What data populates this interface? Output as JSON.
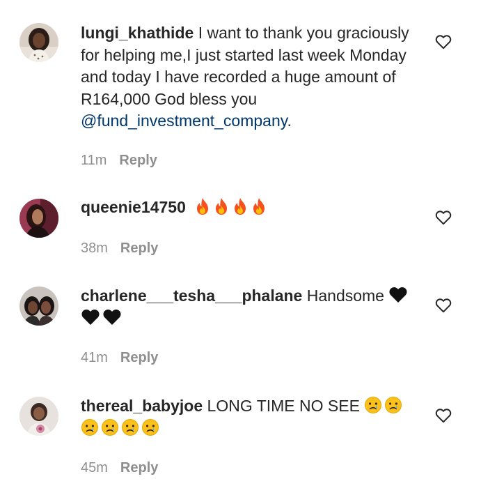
{
  "comments": [
    {
      "username": "lungi_khathide",
      "text": "I want to thank you graciously for helping me,I just started last week Monday and today I have recorded a huge amount of R164,000 God bless you",
      "mention": "@fund_investment_company",
      "text_after": ".",
      "time": "11m",
      "reply_label": "Reply",
      "emojis": []
    },
    {
      "username": "queenie14750",
      "text": "",
      "emojis": [
        "fire",
        "fire",
        "fire",
        "fire"
      ],
      "time": "38m",
      "reply_label": "Reply"
    },
    {
      "username": "charlene___tesha___phalane",
      "text": "Handsome",
      "emojis": [
        "black-heart",
        "black-heart",
        "black-heart"
      ],
      "time": "41m",
      "reply_label": "Reply"
    },
    {
      "username": "thereal_babyjoe",
      "text": "LONG TIME NO SEE",
      "emojis": [
        "crying-face",
        "crying-face",
        "crying-face",
        "crying-face",
        "crying-face",
        "crying-face"
      ],
      "time": "45m",
      "reply_label": "Reply"
    }
  ],
  "icons": {
    "like": "heart-outline-icon"
  },
  "colors": {
    "text": "#262626",
    "secondary": "#8e8e8e",
    "mention": "#00376b"
  }
}
